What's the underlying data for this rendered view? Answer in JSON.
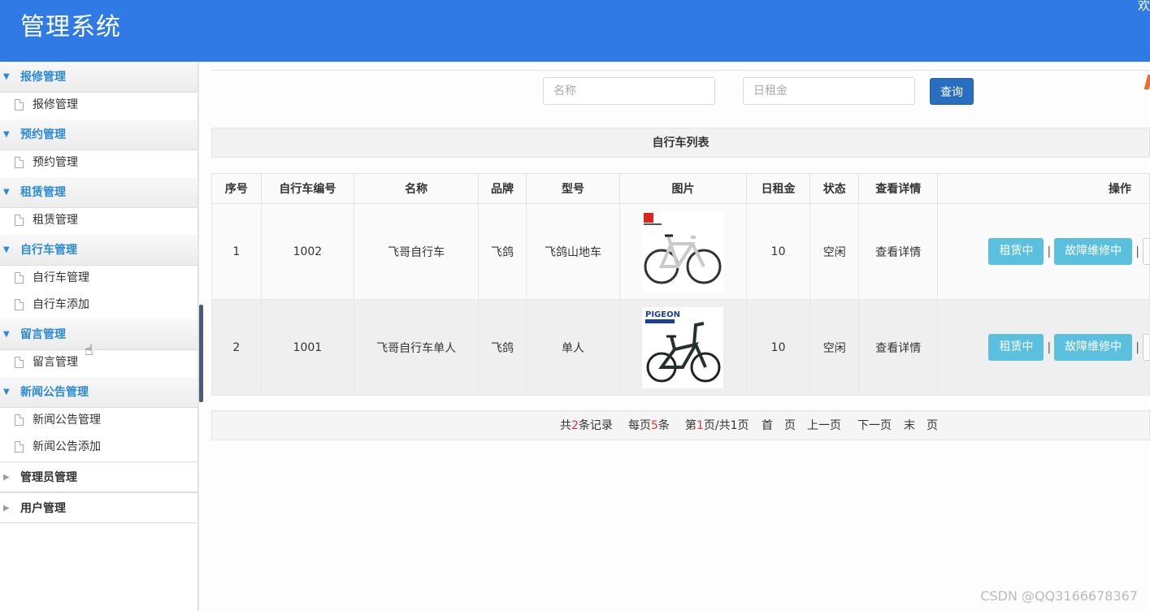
{
  "header": {
    "title": "管理系统",
    "welcome": "欢"
  },
  "sidebar": {
    "groups": [
      {
        "label": "报修管理",
        "items": [
          "报修管理"
        ]
      },
      {
        "label": "预约管理",
        "items": [
          "预约管理"
        ]
      },
      {
        "label": "租赁管理",
        "items": [
          "租赁管理"
        ]
      },
      {
        "label": "自行车管理",
        "items": [
          "自行车管理",
          "自行车添加"
        ]
      },
      {
        "label": "留言管理",
        "items": [
          "留言管理"
        ]
      },
      {
        "label": "新闻公告管理",
        "items": [
          "新闻公告管理",
          "新闻公告添加"
        ]
      }
    ],
    "collapsed": [
      "管理员管理",
      "用户管理"
    ]
  },
  "search": {
    "name_placeholder": "名称",
    "rent_placeholder": "日租金",
    "button": "查询"
  },
  "table": {
    "caption": "自行车列表",
    "headers": [
      "序号",
      "自行车编号",
      "名称",
      "品牌",
      "型号",
      "图片",
      "日租金",
      "状态",
      "查看详情",
      "操作"
    ],
    "rows": [
      {
        "index": "1",
        "code": "1002",
        "name": "飞哥自行车",
        "brand": "飞鸽",
        "model": "飞鸽山地车",
        "image_brand": "",
        "rent": "10",
        "status": "空闲",
        "detail": "查看详情",
        "btn1": "租赁中",
        "btn2": "故障维修中"
      },
      {
        "index": "2",
        "code": "1001",
        "name": "飞哥自行车单人",
        "brand": "飞鸽",
        "model": "单人",
        "image_brand": "PIGEON",
        "rent": "10",
        "status": "空闲",
        "detail": "查看详情",
        "btn1": "租赁中",
        "btn2": "故障维修中"
      }
    ]
  },
  "pager": {
    "total_prefix": "共",
    "total": "2",
    "total_suffix": "条记录",
    "per_prefix": "每页",
    "per": "5",
    "per_suffix": "条",
    "page_prefix": "第",
    "page": "1",
    "page_suffix": "页/共1页",
    "first": "首　页",
    "prev": "上一页",
    "next": "下一页",
    "last": "末　页"
  },
  "watermark": "CSDN @QQ3166678367",
  "colors": {
    "header": "#2f7ae5",
    "accent": "#2b8ad6",
    "button": "#5bc0de",
    "search_button": "#2a6fbf"
  }
}
